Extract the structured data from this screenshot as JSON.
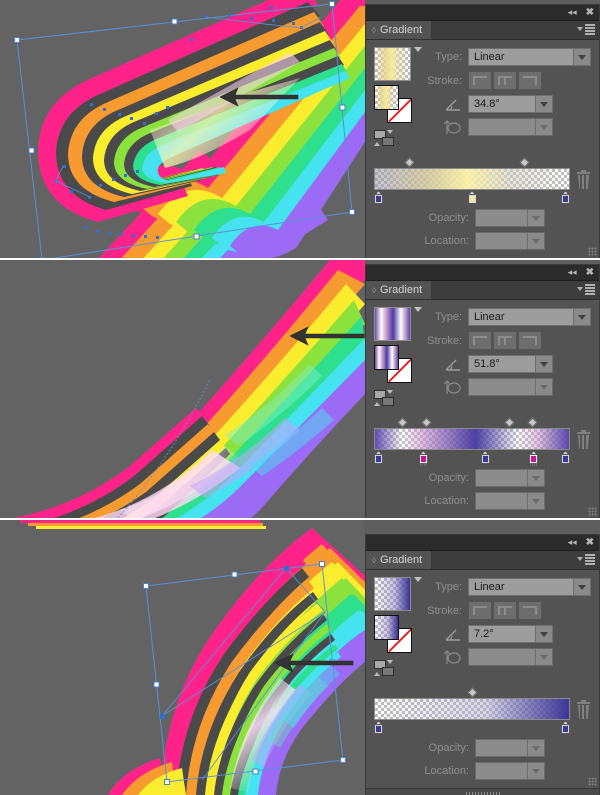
{
  "app": {
    "panel_title": "Gradient",
    "labels": {
      "type": "Type:",
      "stroke": "Stroke:",
      "opacity": "Opacity:",
      "location": "Location:"
    },
    "titlebar": {
      "collapse_icon": "collapse-double-arrow-icon",
      "close_icon": "close-icon",
      "menu_icon": "panel-menu-icon"
    },
    "colors": {
      "panel_bg": "#535353",
      "titlebar_bg": "#2b2b2b",
      "field_bg": "#9d9d9d",
      "label_text": "#8f8f8f",
      "canvas_bg": "#636363",
      "selection_blue": "#5b8fd8"
    }
  },
  "sections": [
    {
      "name": "step-1",
      "panel": {
        "title": "Gradient",
        "type_value": "Linear",
        "angle_value": "34.8°",
        "aspect_value": "",
        "opacity_value": "",
        "location_value": "",
        "swatch_css": "linear-gradient(90deg, rgba(190,190,200,0) 0%, rgba(228,214,150,0.85) 28%, rgba(247,233,150,1) 48%, rgba(225,215,170,0.5) 70%, rgba(255,255,255,0) 100%)",
        "ramp_css": "linear-gradient(90deg, rgba(150,150,175,0.55) 0%, rgba(205,195,150,0.8) 26%, rgba(250,240,165,0.95) 48%, rgba(205,203,190,0.55) 70%, rgba(255,255,255,0) 100%)",
        "stops": [
          {
            "pos": 0,
            "color": "#3b3b8f",
            "selected": false
          },
          {
            "pos": 50,
            "color": "#f2ea9a",
            "selected": false
          },
          {
            "pos": 100,
            "color": "#3b3b8f",
            "selected": false
          }
        ],
        "midpoints": [
          17,
          78
        ]
      },
      "canvas": {
        "artwork": "rainbow-ribbon-swoosh",
        "selection": true,
        "arrow": true
      }
    },
    {
      "name": "step-2",
      "panel": {
        "title": "Gradient",
        "type_value": "Linear",
        "angle_value": "51.8°",
        "aspect_value": "",
        "opacity_value": "",
        "location_value": "",
        "swatch_css": "linear-gradient(90deg, #6a4fa8 0%, #ffffff 18%, #d3a8d8 30%, #4b3a9e 52%, #ffffff 74%, #c8a0d5 86%, #5a4aa5 100%)",
        "ramp_css": "linear-gradient(90deg, rgba(90,70,170,0.95) 0%, rgba(255,255,255,0.15) 14%, rgba(205,150,205,0.6) 24%, rgba(70,55,160,0.95) 52%, rgba(255,255,255,0.12) 74%, rgba(200,150,205,0.55) 84%, rgba(80,65,165,0.95) 100%)",
        "stops": [
          {
            "pos": 0,
            "color": "#3b3b9e",
            "selected": false
          },
          {
            "pos": 24,
            "color": "#c4189c",
            "selected": true
          },
          {
            "pos": 57,
            "color": "#3b3b9e",
            "selected": false
          },
          {
            "pos": 83,
            "color": "#c4189c",
            "selected": true
          },
          {
            "pos": 100,
            "color": "#3b3b9e",
            "selected": false
          }
        ],
        "midpoints": [
          13,
          26,
          70,
          82
        ]
      },
      "canvas": {
        "artwork": "rainbow-ribbon-closeup",
        "selection": false,
        "arrow": true
      }
    },
    {
      "name": "step-3",
      "panel": {
        "title": "Gradient",
        "type_value": "Linear",
        "angle_value": "7.2°",
        "aspect_value": "",
        "opacity_value": "",
        "location_value": "",
        "swatch_css": "linear-gradient(90deg, rgba(255,255,255,0) 0%, rgba(150,140,200,0.55) 55%, rgba(60,50,150,1) 100%)",
        "ramp_css": "linear-gradient(90deg, rgba(255,255,255,0) 0%, rgba(170,165,205,0.45) 58%, rgba(62,52,152,1) 100%)",
        "stops": [
          {
            "pos": 0,
            "color": "#3b3b9e",
            "selected": false
          },
          {
            "pos": 100,
            "color": "#3b3b9e",
            "selected": false
          }
        ],
        "midpoints": [
          50
        ]
      },
      "canvas": {
        "artwork": "rainbow-ribbon-loop",
        "selection": true,
        "arrow": true
      }
    }
  ]
}
